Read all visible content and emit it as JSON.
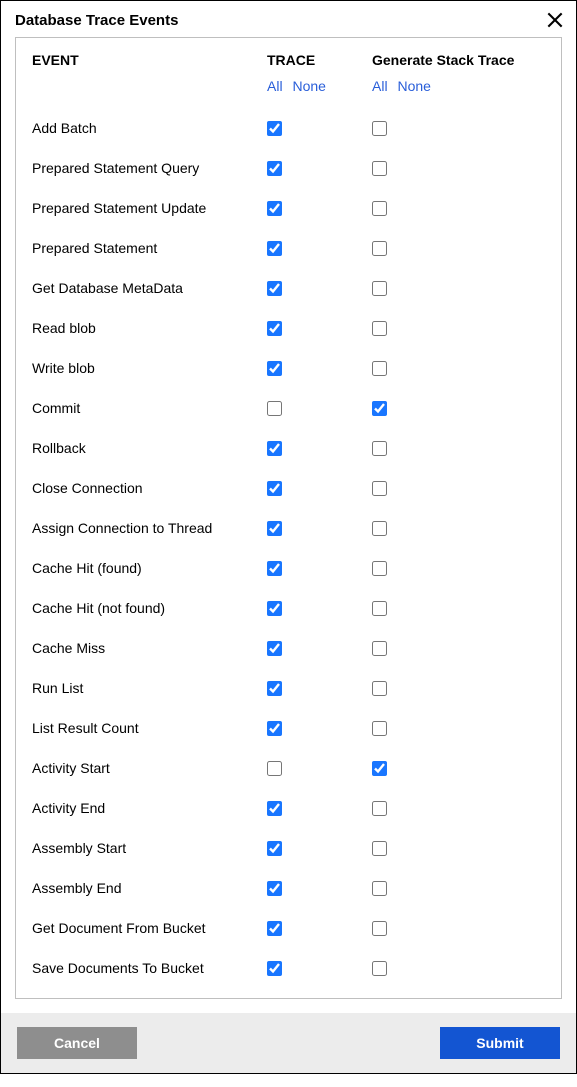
{
  "dialog": {
    "title": "Database Trace Events"
  },
  "headers": {
    "event": "EVENT",
    "trace": "TRACE",
    "stack": "Generate Stack Trace"
  },
  "filters": {
    "all": "All",
    "none": "None"
  },
  "events": [
    {
      "name": "Add Batch",
      "trace": true,
      "stack": false
    },
    {
      "name": "Prepared Statement Query",
      "trace": true,
      "stack": false
    },
    {
      "name": "Prepared Statement Update",
      "trace": true,
      "stack": false
    },
    {
      "name": "Prepared Statement",
      "trace": true,
      "stack": false
    },
    {
      "name": "Get Database MetaData",
      "trace": true,
      "stack": false
    },
    {
      "name": "Read blob",
      "trace": true,
      "stack": false
    },
    {
      "name": "Write blob",
      "trace": true,
      "stack": false
    },
    {
      "name": "Commit",
      "trace": false,
      "stack": true
    },
    {
      "name": "Rollback",
      "trace": true,
      "stack": false
    },
    {
      "name": "Close Connection",
      "trace": true,
      "stack": false
    },
    {
      "name": "Assign Connection to Thread",
      "trace": true,
      "stack": false
    },
    {
      "name": "Cache Hit (found)",
      "trace": true,
      "stack": false
    },
    {
      "name": "Cache Hit (not found)",
      "trace": true,
      "stack": false
    },
    {
      "name": "Cache Miss",
      "trace": true,
      "stack": false
    },
    {
      "name": "Run List",
      "trace": true,
      "stack": false
    },
    {
      "name": "List Result Count",
      "trace": true,
      "stack": false
    },
    {
      "name": "Activity Start",
      "trace": false,
      "stack": true
    },
    {
      "name": "Activity End",
      "trace": true,
      "stack": false
    },
    {
      "name": "Assembly Start",
      "trace": true,
      "stack": false
    },
    {
      "name": "Assembly End",
      "trace": true,
      "stack": false
    },
    {
      "name": "Get Document From Bucket",
      "trace": true,
      "stack": false
    },
    {
      "name": "Save Documents To Bucket",
      "trace": true,
      "stack": false
    }
  ],
  "buttons": {
    "cancel": "Cancel",
    "submit": "Submit"
  }
}
